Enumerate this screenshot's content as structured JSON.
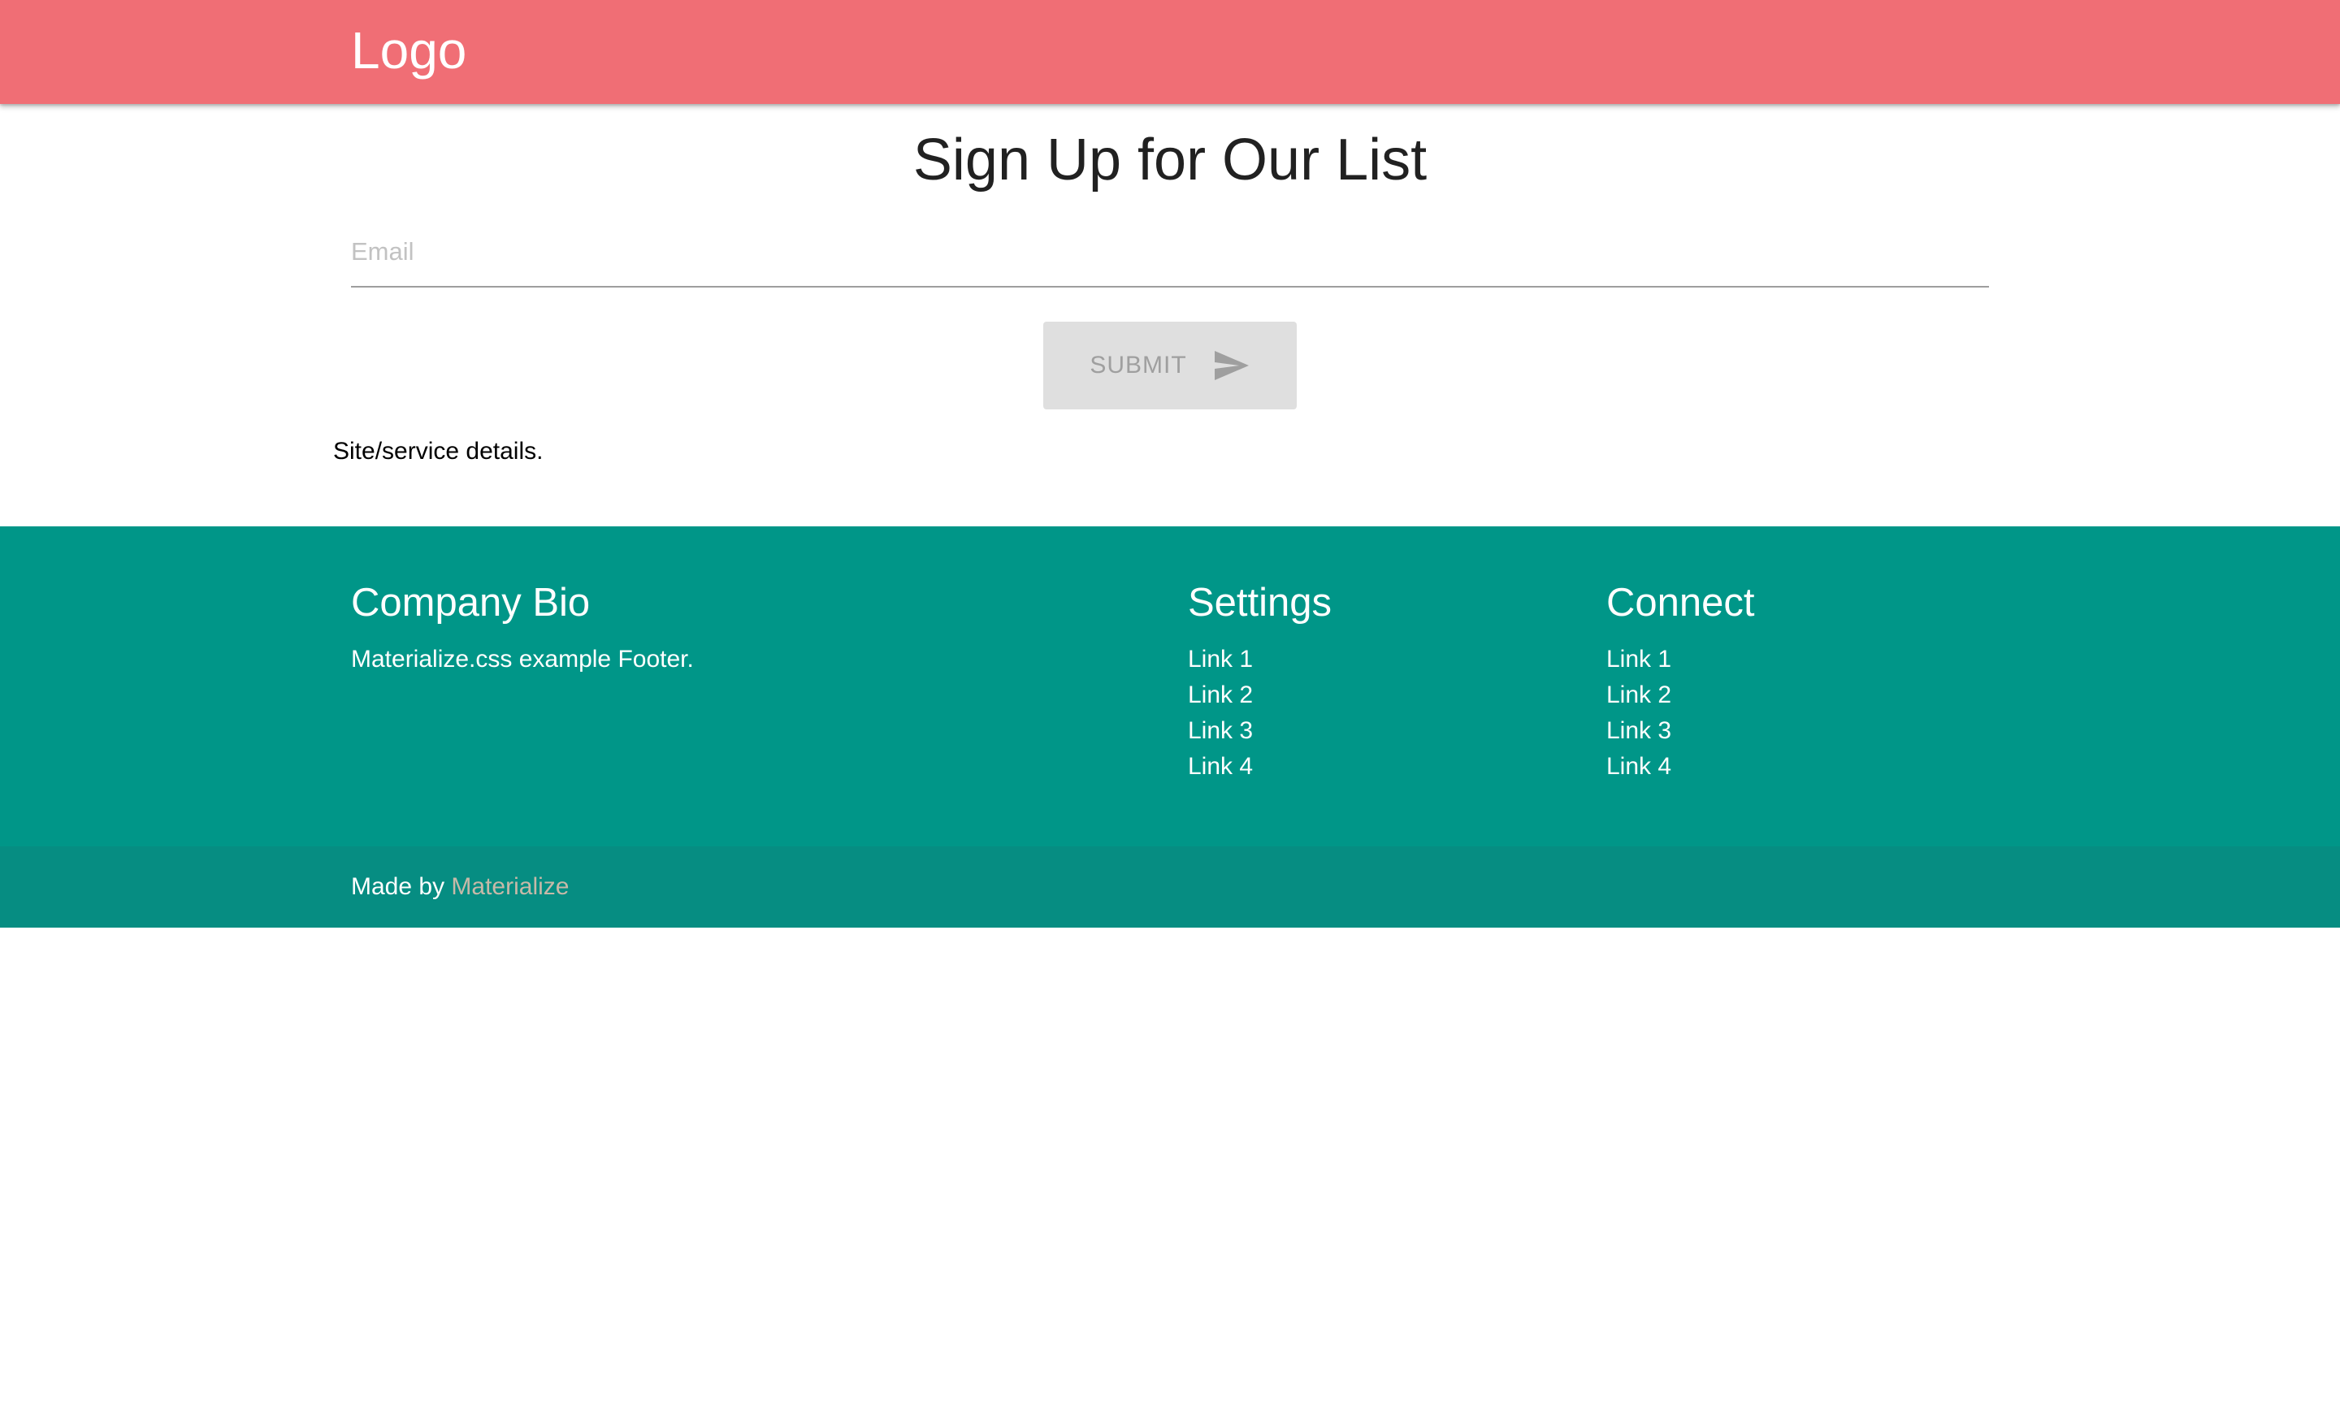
{
  "header": {
    "logo": "Logo"
  },
  "main": {
    "title": "Sign Up for Our List",
    "email_placeholder": "Email",
    "submit_label": "SUBMIT",
    "details": "Site/service details."
  },
  "footer": {
    "bio": {
      "heading": "Company Bio",
      "text": "Materialize.css example Footer."
    },
    "settings": {
      "heading": "Settings",
      "links": [
        "Link 1",
        "Link 2",
        "Link 3",
        "Link 4"
      ]
    },
    "connect": {
      "heading": "Connect",
      "links": [
        "Link 1",
        "Link 2",
        "Link 3",
        "Link 4"
      ]
    },
    "copyright": {
      "prefix": "Made by ",
      "link_label": "Materialize"
    }
  },
  "colors": {
    "header_bg": "#f06e75",
    "footer_bg": "#009688",
    "copyright_bg": "#068d82",
    "button_disabled_bg": "#dfdfdf"
  },
  "icons": {
    "submit": "send-icon"
  }
}
